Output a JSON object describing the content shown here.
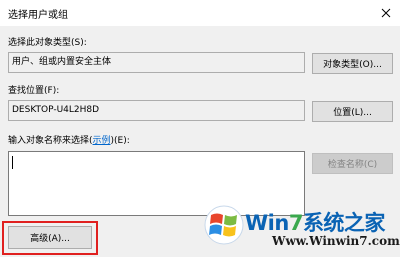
{
  "window": {
    "title": "选择用户或组"
  },
  "object_type": {
    "label": "选择此对象类型(S):",
    "value": "用户、组或内置安全主体",
    "button_label": "对象类型(O)..."
  },
  "location": {
    "label": "查找位置(F):",
    "value": "DESKTOP-U4L2H8D",
    "button_label": "位置(L)..."
  },
  "names": {
    "label_prefix": "输入对象名称来选择(",
    "label_link": "示例",
    "label_suffix": ")(E):",
    "value": "",
    "check_button_label": "检查名称(C)"
  },
  "advanced": {
    "button_label": "高级(A)..."
  },
  "watermark": {
    "brand_prefix": "Win",
    "brand_seven": "7",
    "brand_suffix": "系统之家",
    "url": "Www.Winwin7.com"
  },
  "colors": {
    "highlight": "#e0201f",
    "link": "#0066cc",
    "brand_blue": "#0a63b4",
    "brand_green": "#3aa84d"
  }
}
